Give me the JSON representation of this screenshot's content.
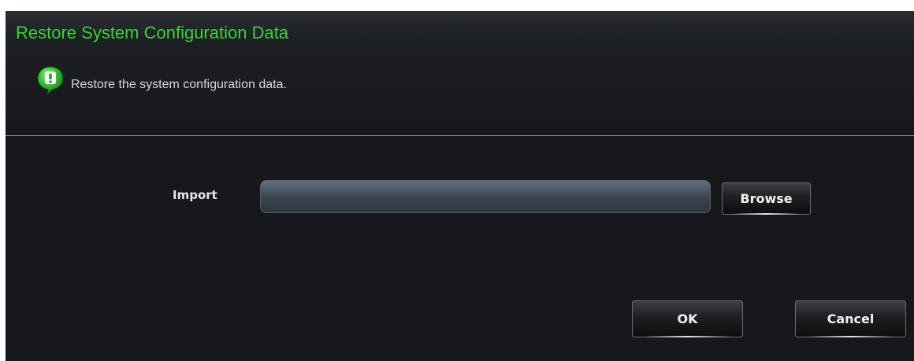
{
  "dialog": {
    "title": "Restore System Configuration Data",
    "info_icon": "info-bubble-icon",
    "info_text": "Restore the system configuration data."
  },
  "import": {
    "label": "Import",
    "value": "",
    "placeholder": ""
  },
  "buttons": {
    "browse_label": "Browse",
    "ok_label": "OK",
    "cancel_label": "Cancel"
  },
  "colors": {
    "title": "#3fd03a",
    "background": "#16181b",
    "icon_green": "#2fc02f"
  }
}
